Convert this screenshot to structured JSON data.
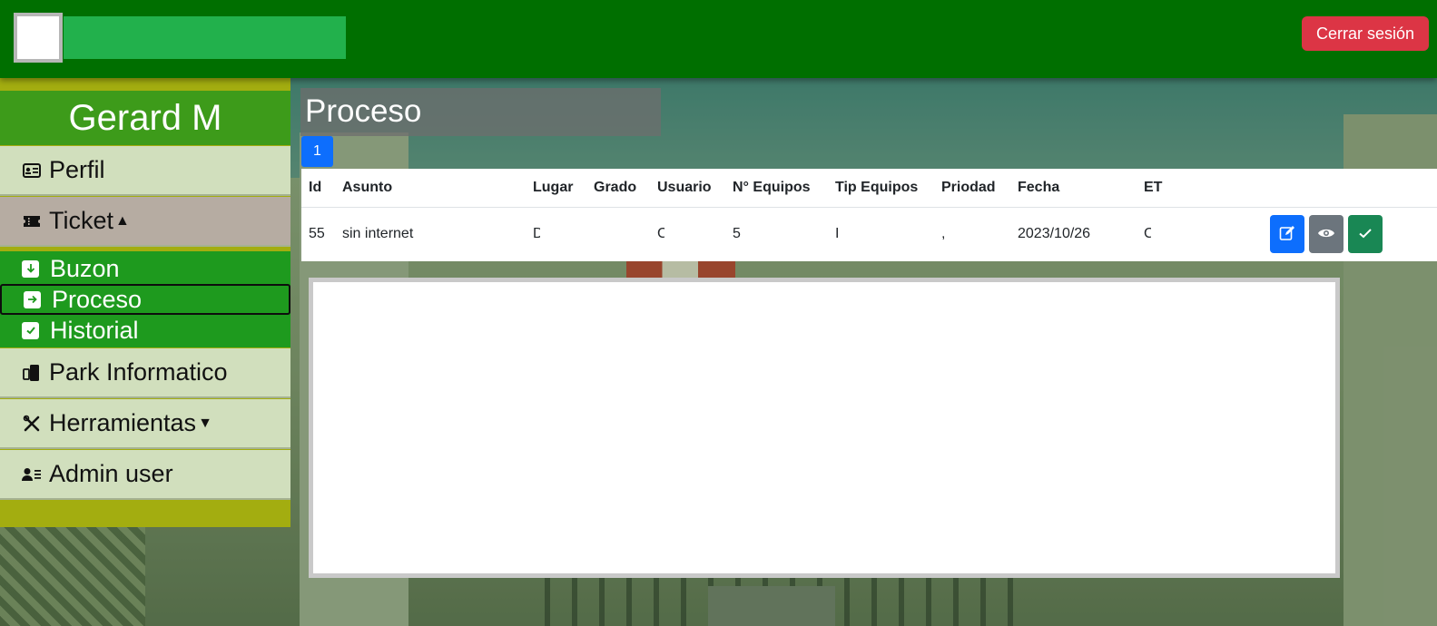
{
  "header": {
    "logout_label": "Cerrar sesión"
  },
  "sidebar": {
    "user_name": "Gerard M",
    "items": [
      {
        "label": "Perfil",
        "icon": "id-card-icon"
      },
      {
        "label": "Ticket",
        "icon": "ticket-icon",
        "caret": "▲"
      },
      {
        "label": "Park Informatico",
        "icon": "devices-icon"
      },
      {
        "label": "Herramientas",
        "icon": "tools-icon",
        "caret": "▼"
      },
      {
        "label": "Admin user",
        "icon": "admin-user-icon"
      }
    ],
    "ticket_submenu": [
      {
        "label": "Buzon",
        "icon": "arrow-down-icon"
      },
      {
        "label": "Proceso",
        "icon": "arrow-right-icon",
        "active": true
      },
      {
        "label": "Historial",
        "icon": "check-icon"
      }
    ]
  },
  "main": {
    "title": "Proceso",
    "page_number": "1",
    "table": {
      "headers": [
        "Id",
        "Asunto",
        "Lugar",
        "Grado",
        "Usuario",
        "N° Equipos",
        "Tip Equipos",
        "Priodad",
        "Fecha",
        "ET"
      ],
      "rows": [
        {
          "id": "55",
          "asunto": "sin internet",
          "lugar": "D",
          "grado": "",
          "usuario": "C",
          "equipos": "5",
          "tip_equipos": "I",
          "prioridad": ",",
          "fecha": "2023/10/26",
          "et": "C"
        }
      ]
    }
  },
  "colors": {
    "header_bg": "#006f00",
    "brand_bar": "#22b14c",
    "logout": "#dc3545",
    "sidebar_frame": "#a3ad10",
    "user_banner": "#3d9b1a",
    "nav_item_bg": "#d1dfbd",
    "ticket_active_bg": "#b6aca2",
    "submenu_bg": "#1e9a1e",
    "primary": "#0d6efd",
    "secondary": "#6c757d",
    "success": "#198754"
  }
}
